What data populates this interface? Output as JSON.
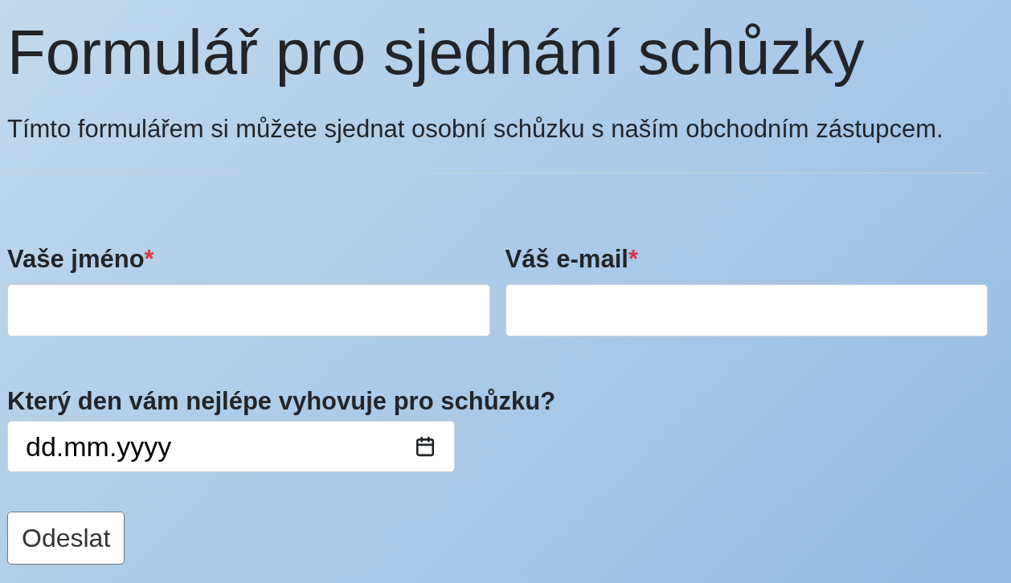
{
  "heading": "Formulář pro sjednání schůzky",
  "intro": "Tímto formulářem si můžete sjednat osobní schůzku s naším obchodním zástupcem.",
  "required_mark": "*",
  "fields": [
    {
      "label": "Vaše jméno",
      "required": true
    },
    {
      "label": "Váš e-mail",
      "required": true
    }
  ],
  "date_field": {
    "label": "Který den vám nejlépe vyhovuje pro schůzku?",
    "placeholder": "dd.mm.yyyy"
  },
  "submit": "Odeslat"
}
